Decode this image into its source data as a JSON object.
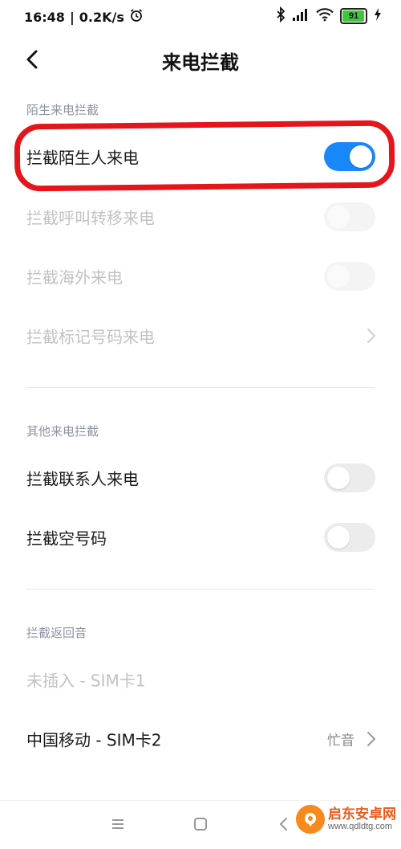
{
  "status_bar": {
    "time": "16:48",
    "separator": "|",
    "net_speed": "0.2K/s",
    "battery_level": "91",
    "battery_fraction": 0.91
  },
  "header": {
    "title": "来电拦截"
  },
  "section_stranger": {
    "header": "陌生来电拦截",
    "items": [
      {
        "label": "拦截陌生人来电",
        "toggle": true,
        "enabled": true
      },
      {
        "label": "拦截呼叫转移来电",
        "toggle": false,
        "enabled": false
      },
      {
        "label": "拦截海外来电",
        "toggle": false,
        "enabled": false
      },
      {
        "label": "拦截标记号码来电",
        "enabled": false
      }
    ]
  },
  "section_other": {
    "header": "其他来电拦截",
    "items": [
      {
        "label": "拦截联系人来电",
        "toggle": false,
        "enabled": true
      },
      {
        "label": "拦截空号码",
        "toggle": false,
        "enabled": true
      }
    ]
  },
  "section_tone": {
    "header": "拦截返回音",
    "items": [
      {
        "label": "未插入 - SIM卡1",
        "enabled": false
      },
      {
        "label": "中国移动 - SIM卡2",
        "value": "忙音",
        "enabled": true
      }
    ]
  },
  "watermark": {
    "title": "启东安卓网",
    "url": "www.qdldtg.com"
  },
  "colors": {
    "accent": "#1987f8",
    "highlight": "#e4161b",
    "section_header": "#8d93a0"
  }
}
